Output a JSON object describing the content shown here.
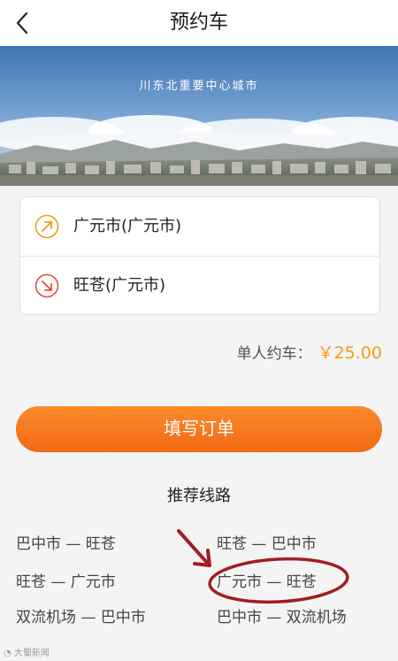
{
  "header": {
    "title": "预约车",
    "back_icon": "chevron-left-icon"
  },
  "banner": {
    "caption": "川东北重要中心城市"
  },
  "route": {
    "from": {
      "icon": "arrow-up-right-icon",
      "text": "广元市(广元市)",
      "color": "#f39c12"
    },
    "to": {
      "icon": "arrow-down-right-icon",
      "text": "旺苍(广元市)",
      "color": "#e74c3c"
    }
  },
  "price": {
    "label": "单人约车：",
    "value": "￥25.00"
  },
  "submit": {
    "label": "填写订单",
    "color": "#f47b20"
  },
  "recommended": {
    "title": "推荐线路",
    "routes": [
      "巴中市 — 旺苍",
      "旺苍 — 巴中市",
      "旺苍 — 广元市",
      "广元市 — 旺苍",
      "双流机场 — 巴中市",
      "巴中市 — 双流机场"
    ]
  },
  "annotation": {
    "color": "#a11d22",
    "highlighted_route": "广元市 — 旺苍"
  },
  "watermark": {
    "text": "大蜀新闻"
  }
}
